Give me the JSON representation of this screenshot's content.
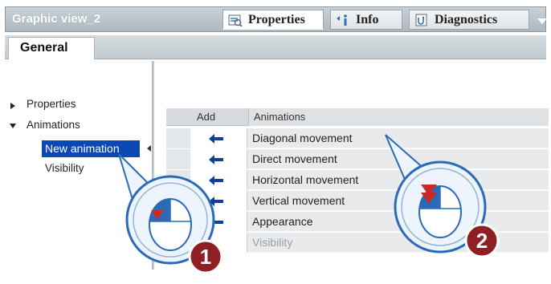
{
  "window": {
    "title": "Graphic view_2"
  },
  "inspector_tabs": [
    {
      "label": "Properties",
      "icon": "properties-icon"
    },
    {
      "label": "Info",
      "icon": "info-icon"
    },
    {
      "label": "Diagnostics",
      "icon": "diagnostics-icon"
    }
  ],
  "sub_tabs": {
    "general": "General"
  },
  "tree": {
    "properties": "Properties",
    "animations": "Animations",
    "new_animation": "New animation",
    "visibility": "Visibility"
  },
  "table": {
    "col_add": "Add",
    "col_animations": "Animations",
    "rows": [
      {
        "label": "Diagonal movement",
        "enabled": true
      },
      {
        "label": "Direct movement",
        "enabled": true
      },
      {
        "label": "Horizontal movement",
        "enabled": true
      },
      {
        "label": "Vertical movement",
        "enabled": true
      },
      {
        "label": "Appearance",
        "enabled": true
      },
      {
        "label": "Visibility",
        "enabled": false
      }
    ]
  },
  "callouts": [
    {
      "number": "1",
      "icon": "mouse-click-icon"
    },
    {
      "number": "2",
      "icon": "mouse-click-icon"
    }
  ],
  "colors": {
    "selection": "#0b48b3",
    "callout_blue": "#2a6ab8",
    "badge_red": "#8e1f23"
  }
}
